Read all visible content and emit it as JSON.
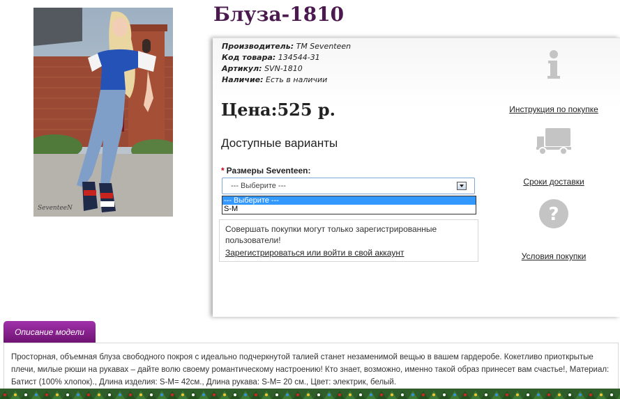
{
  "product": {
    "title": "Блуза-1810",
    "photo_watermark": "SeventeeN"
  },
  "specs": [
    {
      "label": "Производитель:",
      "value": "TM Seventeen"
    },
    {
      "label": "Код товара:",
      "value": "134544-31"
    },
    {
      "label": "Артикул:",
      "value": "SVN-1810"
    },
    {
      "label": "Наличие:",
      "value": "Есть в наличии"
    }
  ],
  "price": "Цена:525 р.",
  "variants": {
    "title": "Доступные варианты",
    "required_mark": "*",
    "label": "Размеры Seventeen:",
    "selected": "--- Выберите ---",
    "options": [
      "--- Выберите ---",
      "S-M"
    ]
  },
  "notice": {
    "text": "Совершать покупки могут только зарегистрированные пользователи!",
    "link": "Зарегистрироваться или войти в свой аккаунт"
  },
  "sidebar": [
    {
      "icon": "info-icon",
      "label": "Инструкция по покупке"
    },
    {
      "icon": "truck-icon",
      "label": "Сроки доставки"
    },
    {
      "icon": "question-icon",
      "label": "Условия покупки"
    }
  ],
  "description": {
    "tab_label": "Описание модели",
    "text": "Просторная, объемная блуза свободного покроя с идеально подчеркнутой талией станет незаменимой вещью в вашем гардеробе. Кокетливо приоткрытые плечи, милые рюши на рукавах – дайте волю своему романтическому настроению! Кто знает, возможно, именно такой образ принесет вам счастье!, Материал: Батист (100% хлопок)., Длина изделия: S-M= 42см., Длина рукава: S-M= 20 см., Цвет: электрик, белый."
  },
  "colors": {
    "title": "#4a1a4e",
    "tab": "#8a1f90",
    "selected_option": "#3399ff",
    "icon_gray": "#c4c4c4"
  }
}
